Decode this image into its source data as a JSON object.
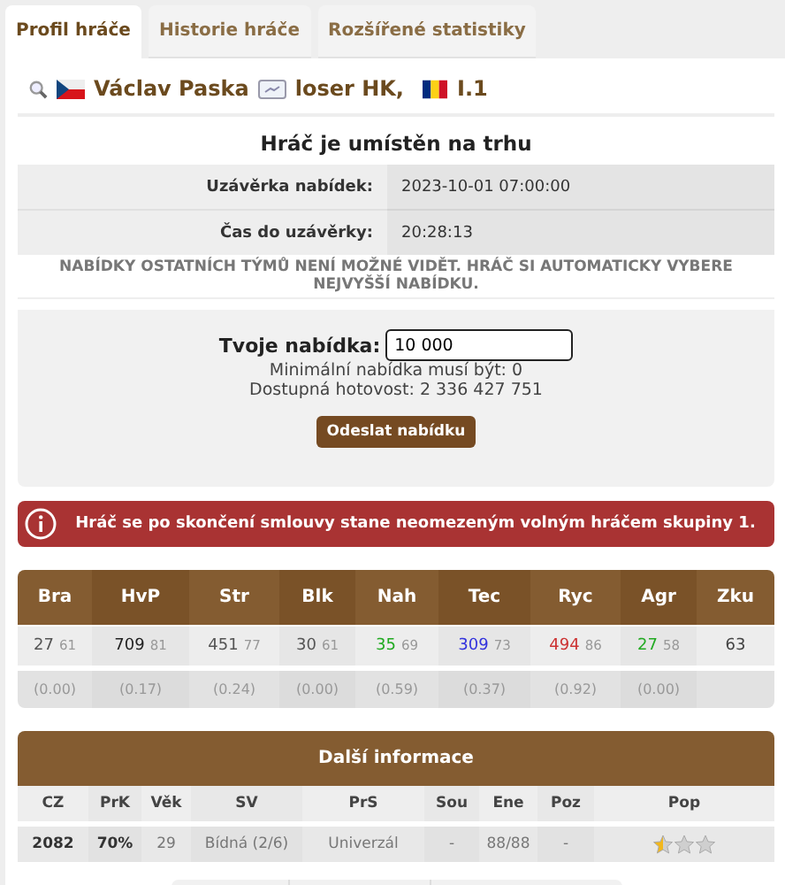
{
  "tabs": [
    {
      "label": "Profil hráče",
      "selected": true
    },
    {
      "label": "Historie hráče",
      "selected": false
    },
    {
      "label": "Rozšířené statistiky",
      "selected": false
    }
  ],
  "player": {
    "name": "Václav Paska",
    "team": "loser HK,",
    "league": "I.1"
  },
  "market": {
    "title": "Hráč je umístěn na trhu",
    "rows": [
      {
        "label": "Uzávěrka nabídek:",
        "value": "2023-10-01 07:00:00"
      },
      {
        "label": "Čas do uzávěrky:",
        "value": "20:28:13"
      }
    ],
    "notice": "NABÍDKY OSTATNÍCH TÝMŮ NENÍ MOŽNÉ VIDĚT. HRÁČ SI AUTOMATICKY VYBERE NEJVYŠŠÍ NABÍDKU."
  },
  "bid": {
    "label": "Tvoje nabídka:",
    "value": "10 000",
    "min": "Minimální nabídka musí být: 0",
    "cash": "Dostupná hotovost: 2 336 427 751",
    "button": "Odeslat nabídku"
  },
  "alert": "Hráč se po skončení smlouvy stane neomezeným volným hráčem skupiny 1.",
  "stats": [
    {
      "label": "Bra",
      "value": "27",
      "sub": "61",
      "ratio": "(0.00)",
      "color": "#555555"
    },
    {
      "label": "HvP",
      "value": "709",
      "sub": "81",
      "ratio": "(0.17)",
      "color": "#222222"
    },
    {
      "label": "Str",
      "value": "451",
      "sub": "77",
      "ratio": "(0.24)",
      "color": "#555555"
    },
    {
      "label": "Blk",
      "value": "30",
      "sub": "61",
      "ratio": "(0.00)",
      "color": "#555555"
    },
    {
      "label": "Nah",
      "value": "35",
      "sub": "69",
      "ratio": "(0.59)",
      "color": "#22aa22"
    },
    {
      "label": "Tec",
      "value": "309",
      "sub": "73",
      "ratio": "(0.37)",
      "color": "#3333dd"
    },
    {
      "label": "Ryc",
      "value": "494",
      "sub": "86",
      "ratio": "(0.92)",
      "color": "#cc3333"
    },
    {
      "label": "Agr",
      "value": "27",
      "sub": "58",
      "ratio": "(0.00)",
      "color": "#22aa22"
    },
    {
      "label": "Zku",
      "value": "63",
      "color": "#444444"
    }
  ],
  "info": {
    "title": "Další informace",
    "columns": [
      "CZ",
      "PrK",
      "Věk",
      "SV",
      "PrS",
      "Sou",
      "Ene",
      "Poz",
      "Pop"
    ],
    "row": [
      "2082",
      "70%",
      "29",
      "Bídná (2/6)",
      "Univerzál",
      "-",
      "88/88",
      "-"
    ],
    "stars": 0.5
  }
}
